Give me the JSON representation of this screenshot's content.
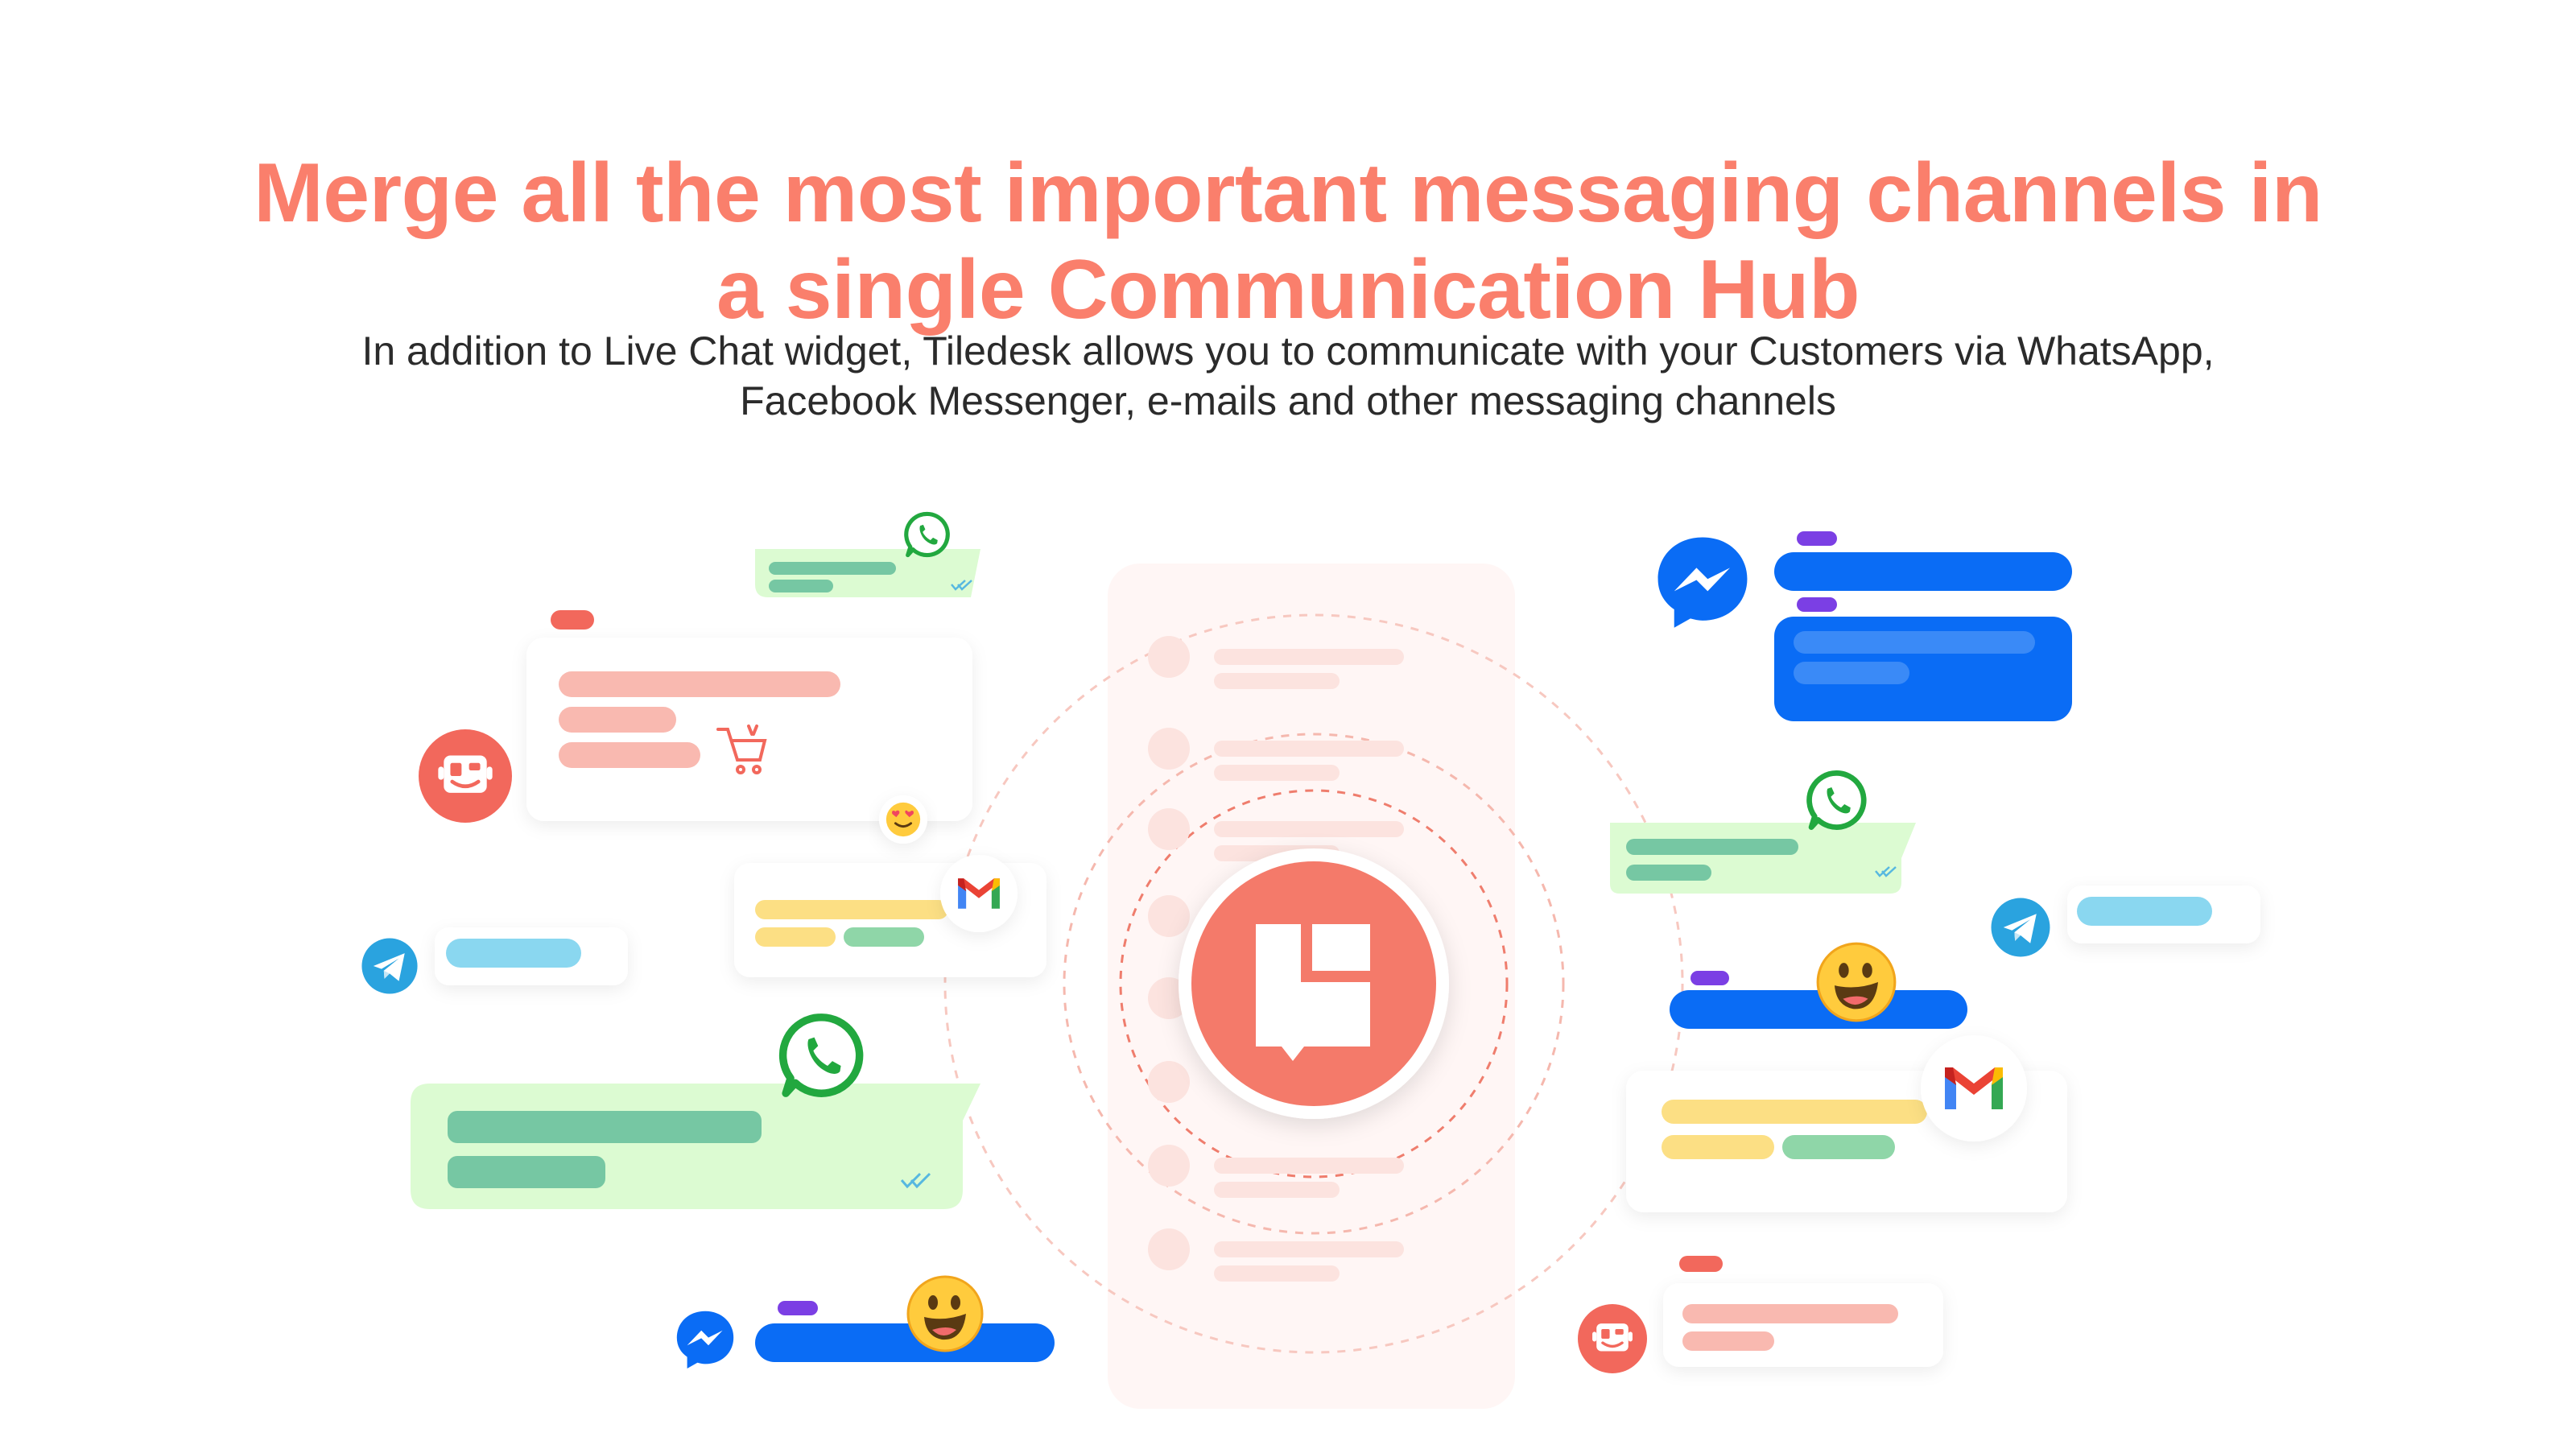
{
  "hero": {
    "title_line_1": "Merge all the most important messaging channels in",
    "title_line_2": "a single Communication Hub",
    "subtitle_line_1": "In addition to Live Chat widget, Tiledesk allows you to communicate with your Customers via WhatsApp,",
    "subtitle_line_2": "Facebook Messenger, e-mails and other messaging channels"
  },
  "colors": {
    "brand_coral": "#fa7f6c",
    "whatsapp_green": "#25d366",
    "messenger_blue": "#0a6cf5",
    "telegram_blue": "#2aa3df",
    "gmail_red": "#ea4335",
    "accent_purple": "#7b3fe4",
    "bubble_green": "#dcfbd2"
  },
  "channel_icons": [
    "whatsapp-icon",
    "messenger-icon",
    "telegram-icon",
    "gmail-icon",
    "tiledesk-bot-icon",
    "tiledesk-logo-icon"
  ]
}
